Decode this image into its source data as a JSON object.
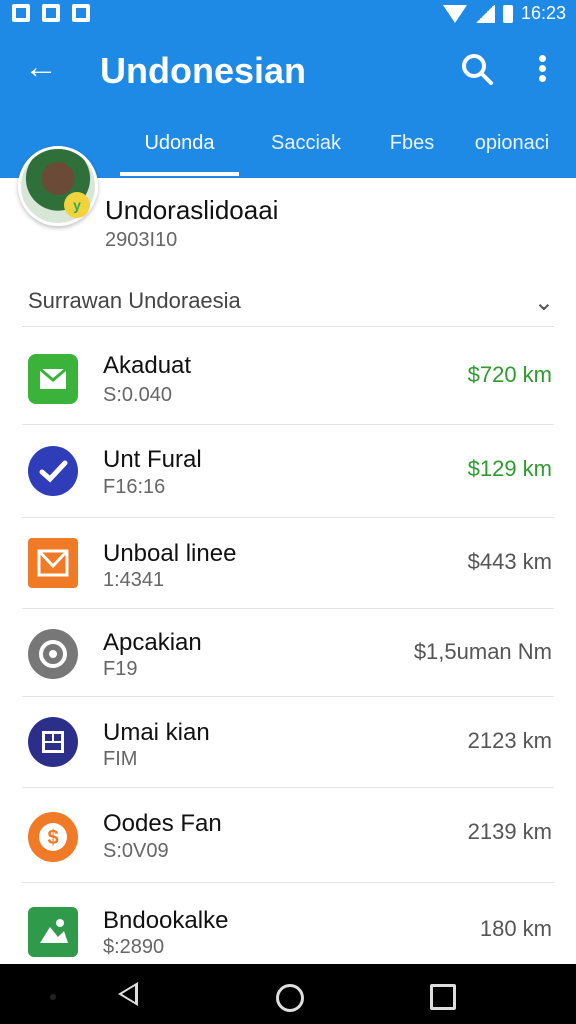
{
  "status": {
    "time": "16:23"
  },
  "appbar": {
    "title": "Undonesian",
    "back_icon": "arrow-left-icon",
    "search_icon": "search-icon",
    "menu_icon": "more-vertical-icon",
    "color": "#1f8ae6"
  },
  "tabs": [
    "Udonda",
    "Sacciak",
    "Fbes",
    "opionaci"
  ],
  "account": {
    "name": "Undoraslidoaai",
    "number": "2903I10",
    "badge": "y"
  },
  "section": {
    "label": "Surrawan Undoraesia"
  },
  "items": [
    {
      "name": "Akaduat",
      "sub": "S:0.040",
      "amount": "$720 km",
      "amount_color": "#2e9b2e",
      "icon": "mail-icon",
      "icon_color": "#3bb33b"
    },
    {
      "name": "Unt Fural",
      "sub": "F16:16",
      "amount": "$129 km",
      "amount_color": "#2e9b2e",
      "icon": "check-circle-icon",
      "icon_color": "#2f3db8"
    },
    {
      "name": "Unboal linee",
      "sub": "1:4341",
      "amount": "$443 km",
      "amount_color": "#555555",
      "icon": "envelope-box-icon",
      "icon_color": "#f07a26"
    },
    {
      "name": "Apcakian",
      "sub": "F19",
      "amount": "$1,5uman Nm",
      "amount_color": "#555555",
      "icon": "target-icon",
      "icon_color": "#777777"
    },
    {
      "name": "Umai kian",
      "sub": "FIM",
      "amount": "2123 km",
      "amount_color": "#555555",
      "icon": "grid-badge-icon",
      "icon_color": "#2b2f8a"
    },
    {
      "name": "Oodes Fan",
      "sub": "S:0V09",
      "amount": "2139 km",
      "amount_color": "#555555",
      "icon": "dollar-circle-icon",
      "icon_color": "#f07a26"
    },
    {
      "name": "Bndookalke",
      "sub": "$:2890",
      "amount": "180 km",
      "amount_color": "#555555",
      "icon": "photo-icon",
      "icon_color": "#2f9b4a"
    }
  ]
}
